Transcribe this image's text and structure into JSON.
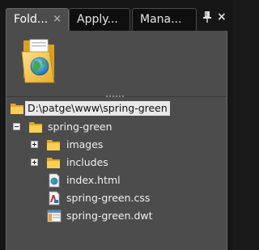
{
  "tabs": [
    {
      "label": "Fold...",
      "close_glyph": "×",
      "active": true
    },
    {
      "label": "Apply...",
      "active": false
    },
    {
      "label": "Mana...",
      "active": false
    }
  ],
  "panel_controls": {
    "pin_icon": "pin-icon",
    "close_glyph": "×"
  },
  "tree": {
    "root_path": "D:\\patge\\www\\spring-green",
    "items": [
      {
        "label": "spring-green",
        "icon": "folder-icon",
        "expander": "minus"
      },
      {
        "label": "images",
        "icon": "folder-icon",
        "expander": "plus"
      },
      {
        "label": "includes",
        "icon": "folder-icon",
        "expander": "plus"
      },
      {
        "label": "index.html",
        "icon": "html-file-icon"
      },
      {
        "label": "spring-green.css",
        "icon": "css-file-icon"
      },
      {
        "label": "spring-green.dwt",
        "icon": "dwt-file-icon"
      }
    ]
  },
  "colors": {
    "panel_bg": "#4c4c4c",
    "frame_bg": "#161616",
    "folder_yellow": "#f3c545",
    "root_highlight": "#e8e8e8"
  }
}
